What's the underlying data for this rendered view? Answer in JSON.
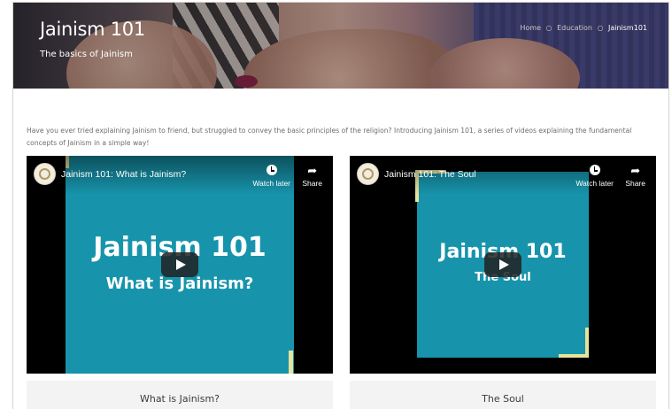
{
  "hero": {
    "title": "Jainism 101",
    "subtitle": "The basics of Jainism",
    "breadcrumb": [
      {
        "label": "Home"
      },
      {
        "label": "Education"
      },
      {
        "label": "Jainism101"
      }
    ],
    "breadcrumb_separator": "○"
  },
  "intro": "Have you ever tried explaining Jainism to friend, but struggled to convey the basic principles of the religion? Introducing Jainism 101, a series of videos explaining the fundamental concepts of Jainism in a simple way!",
  "videos": [
    {
      "title": "Jainism 101: What is Jainism?",
      "thumb_line1": "Jainism 101",
      "thumb_line2": "What is Jainism?",
      "watch_later": "Watch later",
      "share": "Share",
      "caption": "What is Jainism?"
    },
    {
      "title": "Jainism 101: The Soul",
      "thumb_line1": "Jainism 101",
      "thumb_line2": "The Soul",
      "watch_later": "Watch later",
      "share": "Share",
      "caption": "The Soul"
    }
  ],
  "colors": {
    "thumb_teal": "#1794ab",
    "accent_yellow": "#e8e39b"
  },
  "icons": [
    "clock-icon",
    "share-arrow-icon",
    "play-icon",
    "channel-logo-icon"
  ]
}
